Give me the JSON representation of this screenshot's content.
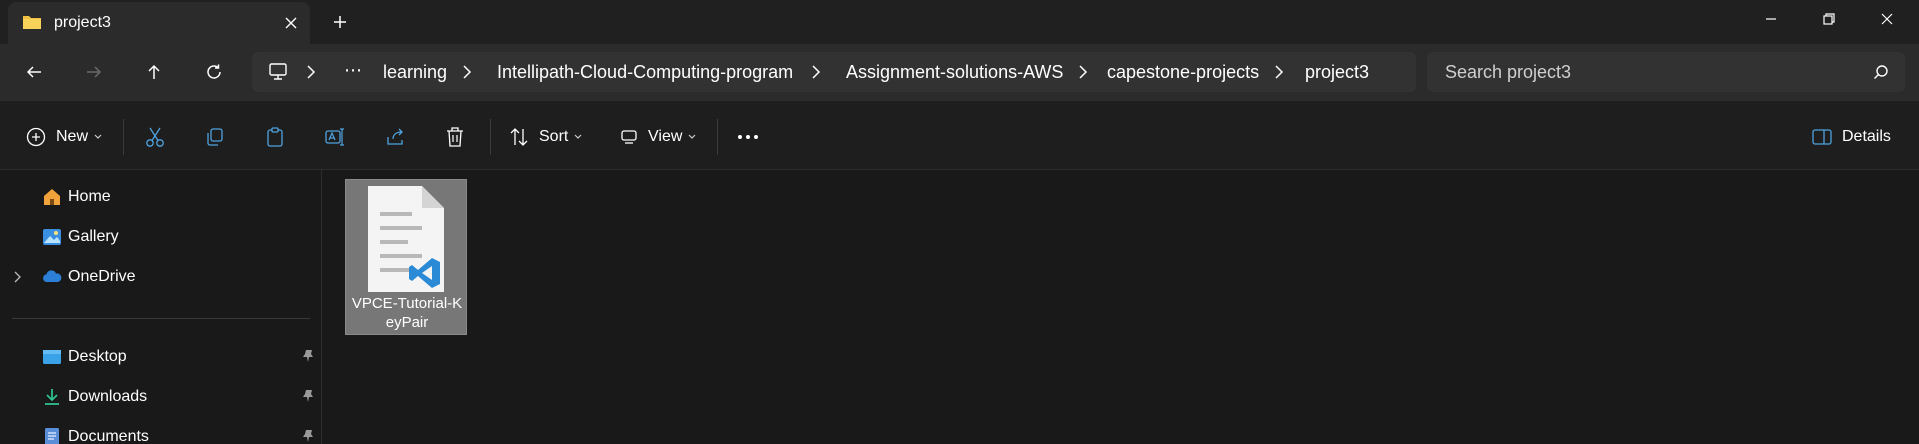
{
  "tab": {
    "title": "project3"
  },
  "breadcrumbs": [
    "learning",
    "Intellipath-Cloud-Computing-program",
    "Assignment-solutions-AWS",
    "capestone-projects",
    "project3"
  ],
  "breadcrumb_overflow": "⋯",
  "search": {
    "placeholder": "Search project3"
  },
  "toolbar": {
    "new_label": "New",
    "sort_label": "Sort",
    "view_label": "View",
    "details_label": "Details"
  },
  "sidebar": {
    "items": [
      {
        "label": "Home"
      },
      {
        "label": "Gallery"
      },
      {
        "label": "OneDrive"
      },
      {
        "label": "Desktop"
      },
      {
        "label": "Downloads"
      },
      {
        "label": "Documents"
      }
    ]
  },
  "files": [
    {
      "name": "VPCE-Tutorial-KeyPair"
    }
  ],
  "colors": {
    "accent_folder": "#f0c040",
    "vscode_blue": "#2b8ad6",
    "onedrive_blue": "#2b7fd6"
  }
}
